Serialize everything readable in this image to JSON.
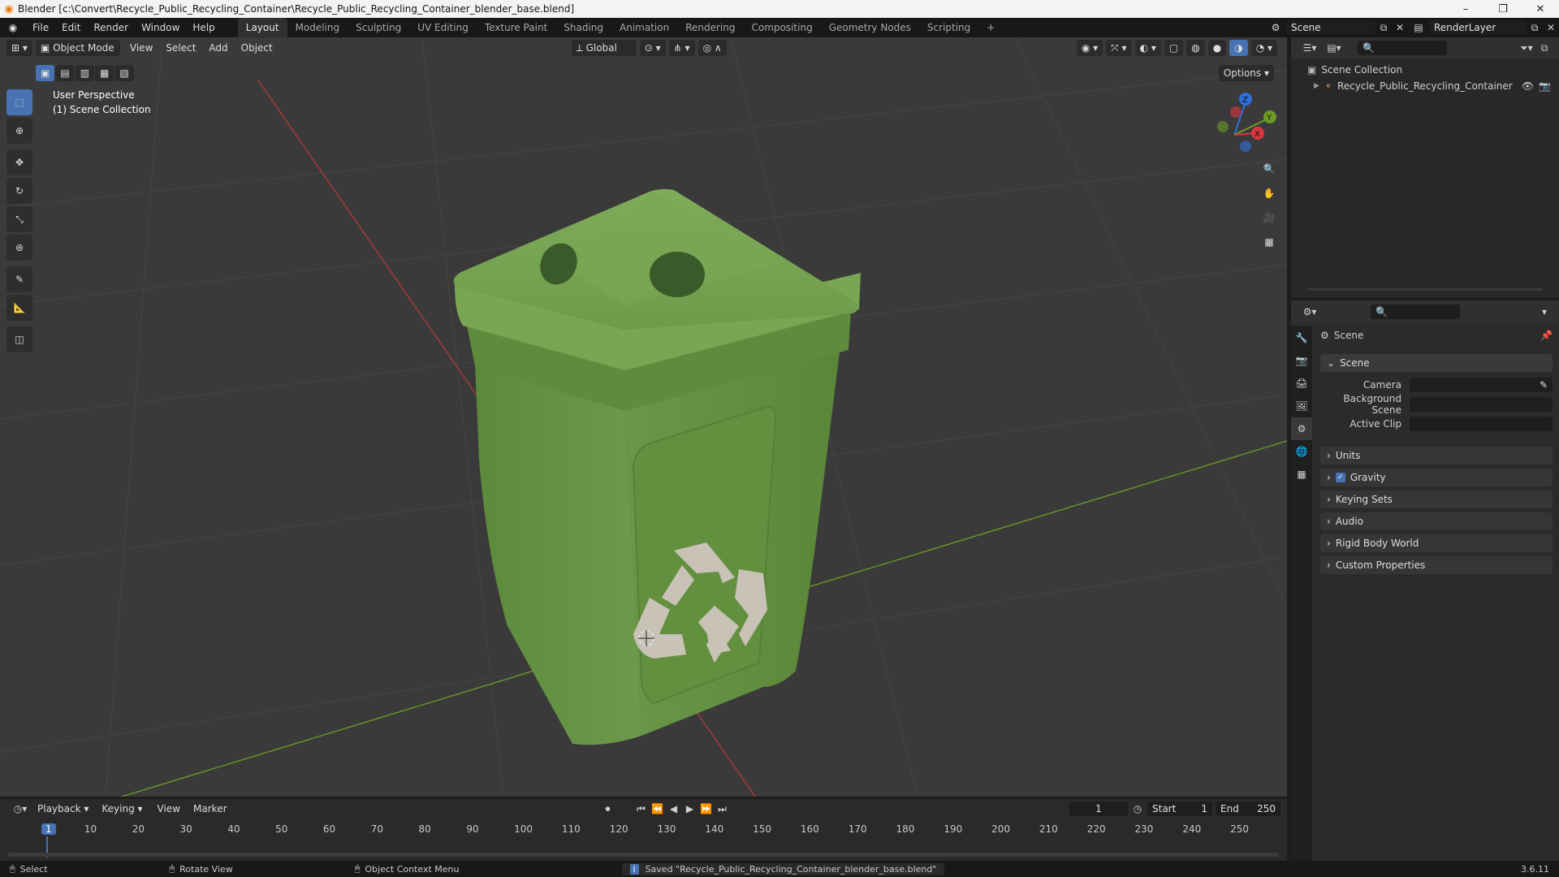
{
  "window": {
    "title": "Blender [c:\\Convert\\Recycle_Public_Recycling_Container\\Recycle_Public_Recycling_Container_blender_base.blend]",
    "controls": [
      "–",
      "❐",
      "✕"
    ]
  },
  "topbar": {
    "menus": [
      "File",
      "Edit",
      "Render",
      "Window",
      "Help"
    ],
    "workspaces": [
      "Layout",
      "Modeling",
      "Sculpting",
      "UV Editing",
      "Texture Paint",
      "Shading",
      "Animation",
      "Rendering",
      "Compositing",
      "Geometry Nodes",
      "Scripting"
    ],
    "active_workspace": "Layout",
    "add_tab": "+",
    "scene_name": "Scene",
    "view_layer": "RenderLayer"
  },
  "viewport": {
    "mode": "Object Mode",
    "menus": [
      "View",
      "Select",
      "Add",
      "Object"
    ],
    "transform_orientation": "Global",
    "options_label": "Options",
    "overlay_line1": "User Perspective",
    "overlay_line2": "(1) Scene Collection",
    "axis_x_color": "#d9363e",
    "axis_y_color": "#6d9a26",
    "axis_z_color": "#2e6fd9",
    "gizmo_labels": {
      "x": "X",
      "y": "Y",
      "z": "Z"
    },
    "object_color": "#6e9a4a"
  },
  "outliner": {
    "root": "Scene Collection",
    "items": [
      {
        "label": "Recycle_Public_Recycling_Container"
      }
    ]
  },
  "properties": {
    "context": "Scene",
    "section": "Scene",
    "fields": [
      {
        "label": "Camera",
        "value": ""
      },
      {
        "label": "Background Scene",
        "value": ""
      },
      {
        "label": "Active Clip",
        "value": ""
      }
    ],
    "panels": [
      "Units",
      "Gravity",
      "Keying Sets",
      "Audio",
      "Rigid Body World",
      "Custom Properties"
    ],
    "gravity_checked": true
  },
  "timeline": {
    "menus": [
      "Playback",
      "Keying",
      "View",
      "Marker"
    ],
    "current_frame": "1",
    "start_label": "Start",
    "start": "1",
    "end_label": "End",
    "end": "250",
    "ticks": [
      "1",
      "10",
      "20",
      "30",
      "40",
      "50",
      "60",
      "70",
      "80",
      "90",
      "100",
      "110",
      "120",
      "130",
      "140",
      "150",
      "160",
      "170",
      "180",
      "190",
      "200",
      "210",
      "220",
      "230",
      "240",
      "250"
    ]
  },
  "statusbar": {
    "select": "Select",
    "rotate": "Rotate View",
    "context_menu": "Object Context Menu",
    "message": "Saved \"Recycle_Public_Recycling_Container_blender_base.blend\"",
    "version": "3.6.11"
  }
}
